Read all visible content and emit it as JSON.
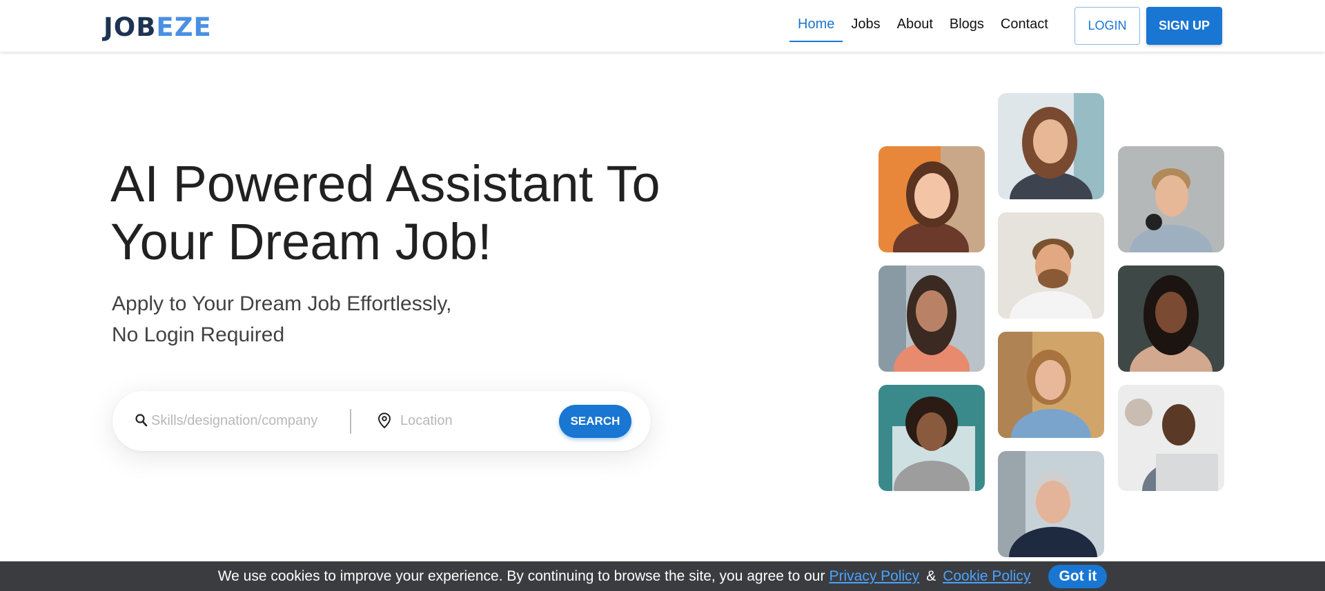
{
  "header": {
    "logo_part1": "JOB",
    "logo_part2": "EZE",
    "nav": [
      "Home",
      "Jobs",
      "About",
      "Blogs",
      "Contact"
    ],
    "active_nav": "Home",
    "login_label": "LOGIN",
    "signup_label": "SIGN UP"
  },
  "hero": {
    "title_line1": "AI Powered Assistant To",
    "title_line2": "Your Dream Job!",
    "subtitle_line1": "Apply to Your Dream Job Effortlessly,",
    "subtitle_line2": "No Login Required"
  },
  "search": {
    "skills_placeholder": "Skills/designation/company",
    "location_placeholder": "Location",
    "button_label": "SEARCH"
  },
  "cookie": {
    "text": "We use cookies to improve your experience. By continuing to browse the site, you agree to our",
    "privacy_link": "Privacy Policy",
    "amp": "&",
    "cookie_link": "Cookie Policy",
    "button_label": "Got it"
  },
  "colors": {
    "brand_dark": "#1d3353",
    "brand_light": "#4a90e2",
    "primary": "#1976d2",
    "cookie_bg": "#3a3c40"
  }
}
